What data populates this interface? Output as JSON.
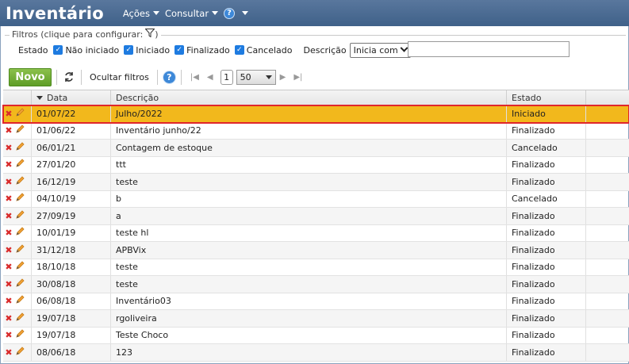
{
  "header": {
    "title": "Inventário",
    "menu": {
      "acoes": "Ações",
      "consultar": "Consultar",
      "help": "?"
    }
  },
  "filters": {
    "legend": "Filtros (clique para configurar:",
    "legend_close": ")",
    "estado_label": "Estado",
    "checkboxes": [
      "Não iniciado",
      "Iniciado",
      "Finalizado",
      "Cancelado"
    ],
    "descricao_label": "Descrição",
    "descricao_mode": "Inicia com",
    "descricao_value": ""
  },
  "toolbar": {
    "novo": "Novo",
    "ocultar_filtros": "Ocultar filtros",
    "help": "?",
    "page": "1",
    "page_size": "50"
  },
  "table": {
    "columns": {
      "data": "Data",
      "descricao": "Descrição",
      "estado": "Estado"
    },
    "rows": [
      {
        "data": "01/07/22",
        "descricao": "Julho/2022",
        "estado": "Iniciado"
      },
      {
        "data": "01/06/22",
        "descricao": "Inventário junho/22",
        "estado": "Finalizado"
      },
      {
        "data": "06/01/21",
        "descricao": "Contagem de estoque",
        "estado": "Cancelado"
      },
      {
        "data": "27/01/20",
        "descricao": "ttt",
        "estado": "Finalizado"
      },
      {
        "data": "16/12/19",
        "descricao": "teste",
        "estado": "Finalizado"
      },
      {
        "data": "04/10/19",
        "descricao": "b",
        "estado": "Cancelado"
      },
      {
        "data": "27/09/19",
        "descricao": "a",
        "estado": "Finalizado"
      },
      {
        "data": "10/01/19",
        "descricao": "teste hl",
        "estado": "Finalizado"
      },
      {
        "data": "31/12/18",
        "descricao": "APBVix",
        "estado": "Finalizado"
      },
      {
        "data": "18/10/18",
        "descricao": "teste",
        "estado": "Finalizado"
      },
      {
        "data": "30/08/18",
        "descricao": "teste",
        "estado": "Finalizado"
      },
      {
        "data": "06/08/18",
        "descricao": "Inventário03",
        "estado": "Finalizado"
      },
      {
        "data": "19/07/18",
        "descricao": "rgoliveira",
        "estado": "Finalizado"
      },
      {
        "data": "19/07/18",
        "descricao": "Teste Choco",
        "estado": "Finalizado"
      },
      {
        "data": "08/06/18",
        "descricao": "123",
        "estado": "Finalizado"
      }
    ]
  }
}
